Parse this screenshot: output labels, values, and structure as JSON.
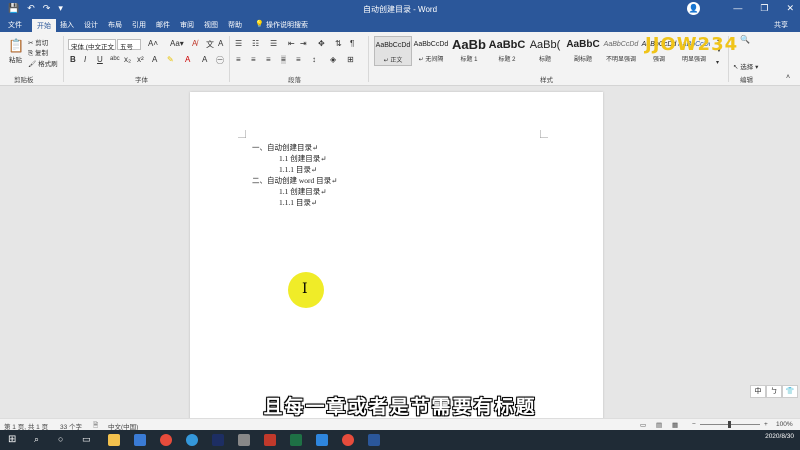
{
  "window": {
    "title": "自动创建目录 - Word",
    "user_initial": "👤",
    "controls": [
      "—",
      "❐",
      "✕"
    ]
  },
  "quick_access": [
    "💾",
    "↶",
    "↷",
    "▾"
  ],
  "menu": {
    "tabs": [
      "文件",
      "开始",
      "插入",
      "设计",
      "布局",
      "引用",
      "邮件",
      "审阅",
      "视图",
      "帮助"
    ],
    "active": "开始",
    "search": "操作说明搜索",
    "share": "共享"
  },
  "ribbon": {
    "clipboard": {
      "paste": "粘贴",
      "cut": "剪切",
      "copy": "复制",
      "format_painter": "格式刷",
      "label": "剪贴板"
    },
    "font": {
      "name": "宋体 (中文正文",
      "size": "五号",
      "label": "字体"
    },
    "paragraph": {
      "label": "段落"
    },
    "styles": {
      "label": "样式",
      "items": [
        {
          "sample": "AaBbCcDd",
          "name": "↵ 正文"
        },
        {
          "sample": "AaBbCcDd",
          "name": "↵ 无间隔"
        },
        {
          "sample": "AaBb",
          "name": "标题 1"
        },
        {
          "sample": "AaBbC",
          "name": "标题 2"
        },
        {
          "sample": "AaBb(",
          "name": "标题"
        },
        {
          "sample": "AaBbC",
          "name": "副标题"
        },
        {
          "sample": "AaBbCcDd",
          "name": "不明显强调"
        },
        {
          "sample": "AaBbCcDd",
          "name": "强调"
        },
        {
          "sample": "AaBbCcDd",
          "name": "明显强调"
        }
      ]
    },
    "editing": {
      "select": "选择",
      "label": "编辑"
    }
  },
  "logo_text": "JJOW234",
  "document": {
    "lines": [
      {
        "text": "一、自动创建目录↵",
        "indent": 0
      },
      {
        "text": "1.1 创建目录↵",
        "indent": 1
      },
      {
        "text": "1.1.1 目录↵",
        "indent": 1
      },
      {
        "text": "二、自动创建 word 目录↵",
        "indent": 0
      },
      {
        "text": "1.1 创建目录↵",
        "indent": 1
      },
      {
        "text": "1.1.1 目录↵",
        "indent": 1
      }
    ]
  },
  "subtitle": "且每一章或者是节需要有标题",
  "ime": [
    "中",
    "ㄅ",
    "👕"
  ],
  "status": {
    "page": "第 1 页, 共 1 页",
    "words": "33 个字",
    "language": "中文(中国)",
    "zoom": "100%"
  },
  "tray": {
    "time": "",
    "date": "2020/8/30"
  },
  "colors": {
    "brand": "#2b579a",
    "highlight": "#f0ec28",
    "taskbar": "#1f2b36"
  }
}
